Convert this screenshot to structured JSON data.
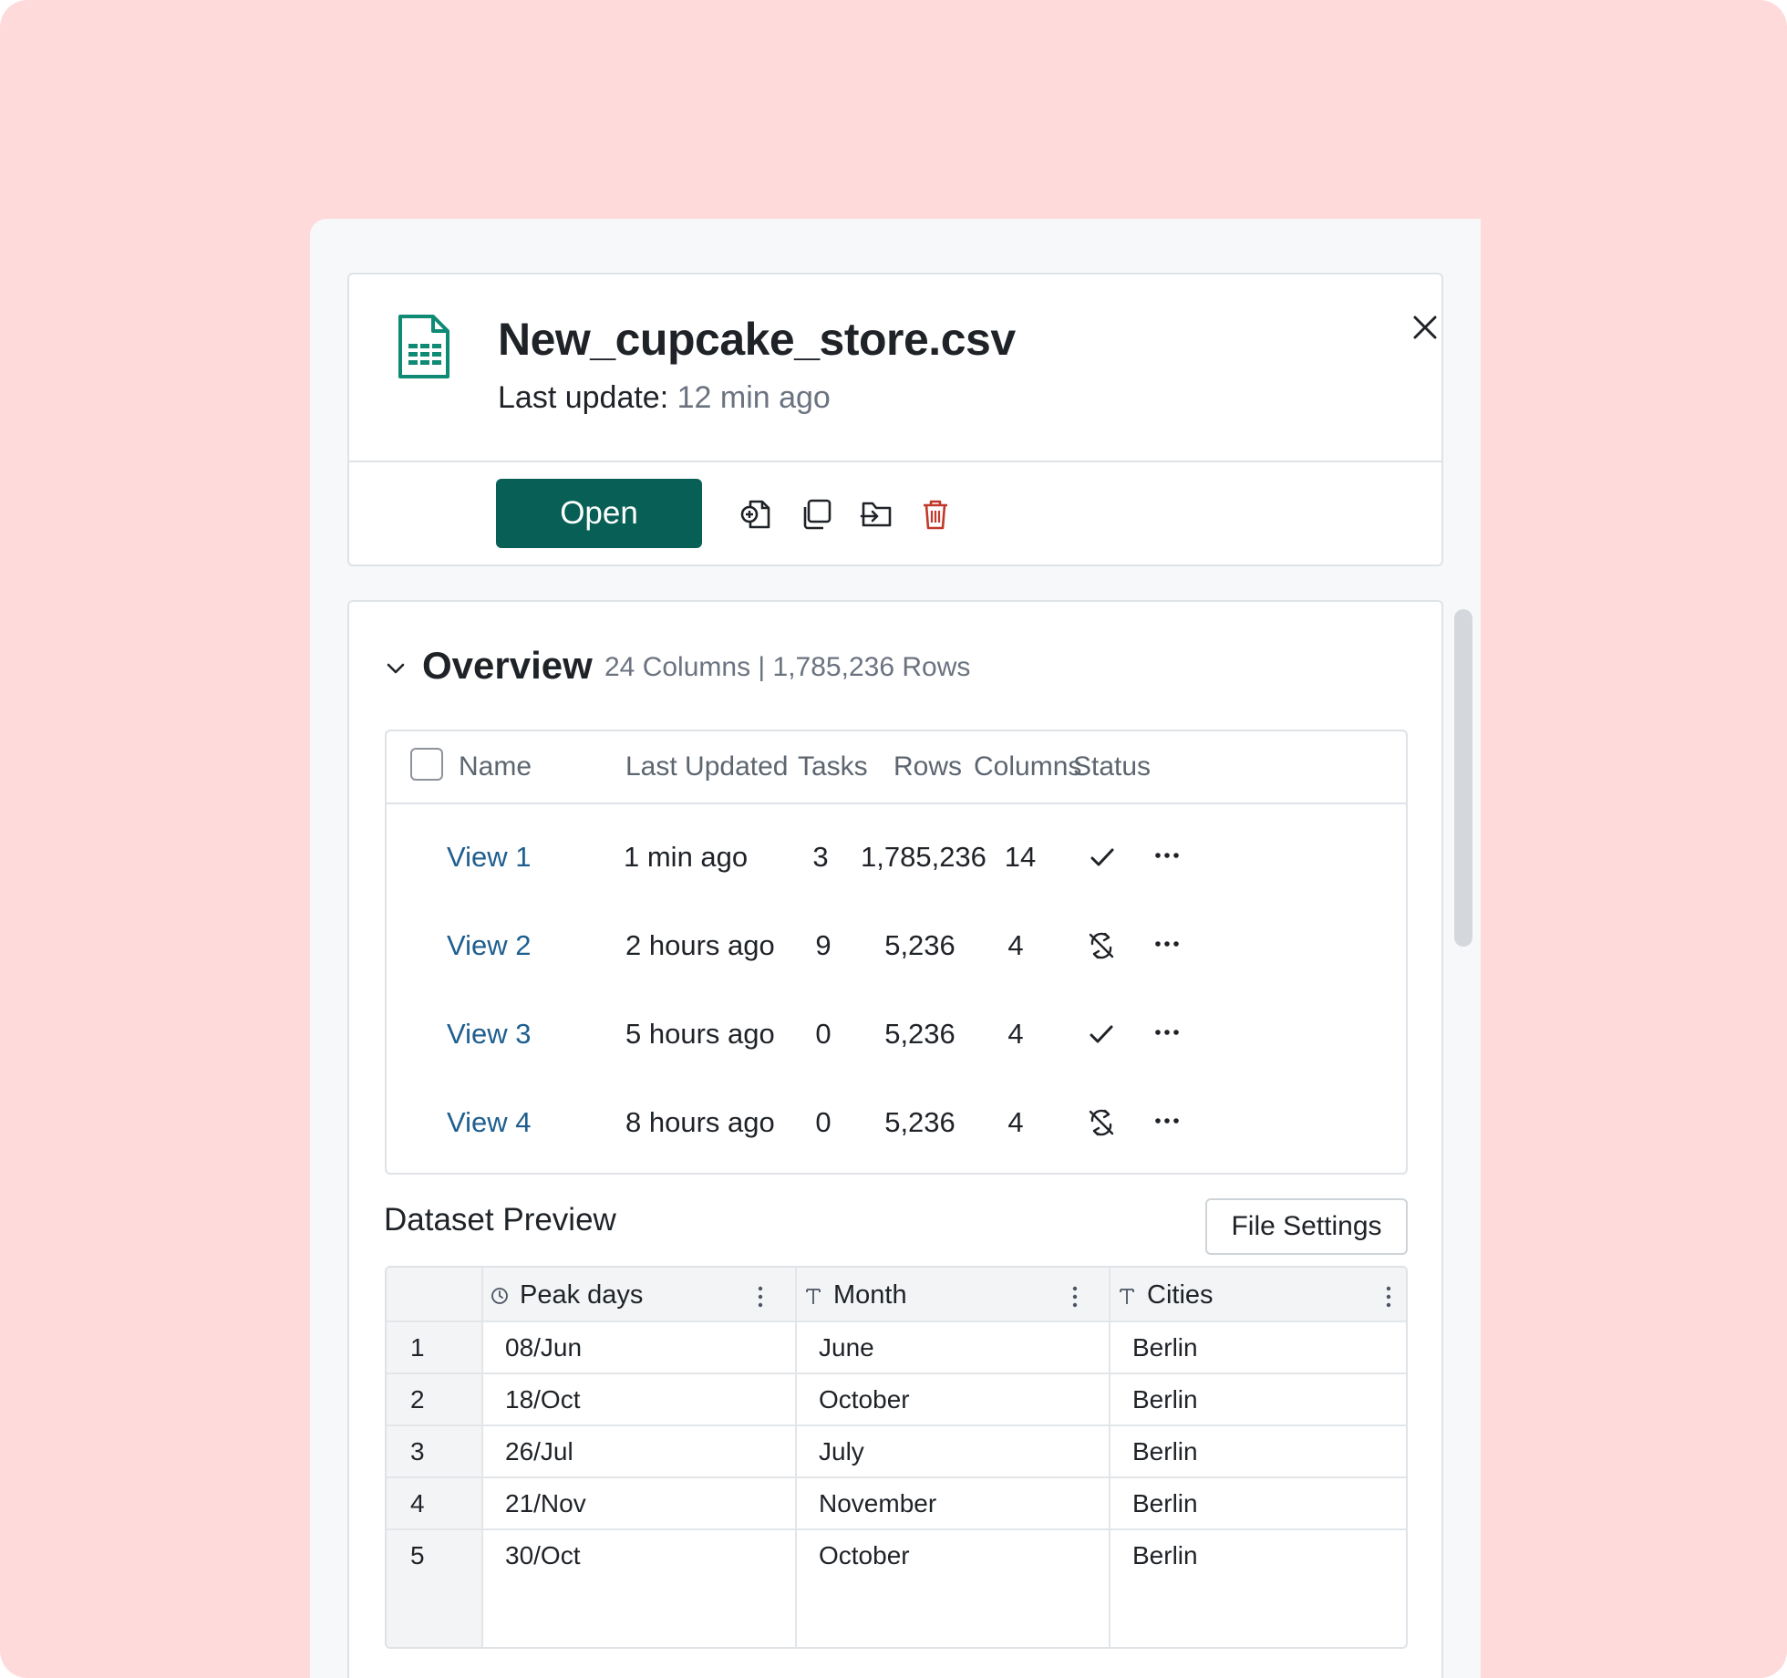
{
  "file": {
    "title": "New_cupcake_store.csv",
    "last_update_label": "Last update:",
    "last_update_value": "12 min ago",
    "icon": "spreadsheet-file-icon"
  },
  "toolbar": {
    "open_label": "Open",
    "icons": [
      "add-file-icon",
      "duplicate-icon",
      "move-to-folder-icon",
      "trash-icon"
    ]
  },
  "overview": {
    "title": "Overview",
    "meta": "24 Columns | 1,785,236  Rows",
    "headers": {
      "name": "Name",
      "last_updated": "Last Updated",
      "tasks": "Tasks",
      "rows": "Rows",
      "columns": "Columns",
      "status": "Status"
    },
    "views": [
      {
        "name": "View 1",
        "last_updated": "1 min ago",
        "tasks": "3",
        "rows": "1,785,236",
        "columns": "14",
        "status": "synced"
      },
      {
        "name": "View 2",
        "last_updated": "2 hours ago",
        "tasks": "9",
        "rows": "5,236",
        "columns": "4",
        "status": "sync-off"
      },
      {
        "name": "View 3",
        "last_updated": "5 hours ago",
        "tasks": "0",
        "rows": "5,236",
        "columns": "4",
        "status": "synced"
      },
      {
        "name": "View 4",
        "last_updated": "8 hours ago",
        "tasks": "0",
        "rows": "5,236",
        "columns": "4",
        "status": "sync-off"
      }
    ]
  },
  "preview": {
    "title": "Dataset Preview",
    "file_settings_label": "File Settings",
    "columns": [
      {
        "label": "Peak days",
        "type_icon": "clock-icon"
      },
      {
        "label": "Month",
        "type_icon": "text-type-icon"
      },
      {
        "label": "Cities",
        "type_icon": "text-type-icon"
      }
    ],
    "rows": [
      {
        "index": "1",
        "peak_days": "08/Jun",
        "month": "June",
        "city": "Berlin"
      },
      {
        "index": "2",
        "peak_days": "18/Oct",
        "month": "October",
        "city": "Berlin"
      },
      {
        "index": "3",
        "peak_days": "26/Jul",
        "month": "July",
        "city": "Berlin"
      },
      {
        "index": "4",
        "peak_days": "21/Nov",
        "month": "November",
        "city": "Berlin"
      },
      {
        "index": "5",
        "peak_days": "30/Oct",
        "month": "October",
        "city": "Berlin"
      }
    ]
  },
  "colors": {
    "background": "#ffdada",
    "primary": "#075f55",
    "link": "#1e5f8f",
    "danger": "#c0392b",
    "muted_text": "#6b7280"
  }
}
